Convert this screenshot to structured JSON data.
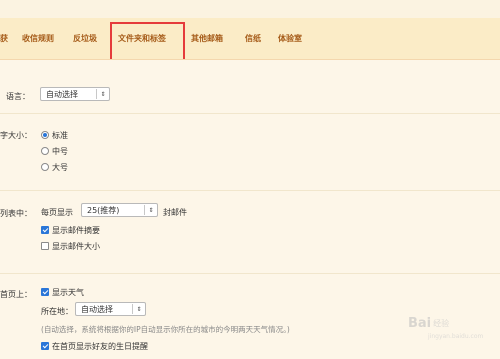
{
  "tabs": [
    {
      "label": "获"
    },
    {
      "label": "收信规则"
    },
    {
      "label": "反垃圾"
    },
    {
      "label": "文件夹和标签"
    },
    {
      "label": "其他邮箱"
    },
    {
      "label": "信纸"
    },
    {
      "label": "体验室"
    }
  ],
  "settings": {
    "language": {
      "label": "语言：",
      "value": "自动选择"
    },
    "font_size": {
      "label": "字大小：",
      "options": [
        {
          "label": "标准",
          "selected": true
        },
        {
          "label": "中号",
          "selected": false
        },
        {
          "label": "大号",
          "selected": false
        }
      ]
    },
    "mail_list": {
      "label": "列表中：",
      "per_page_prefix": "每页显示",
      "per_page_value": "25(推荐)",
      "per_page_suffix": "封邮件",
      "show_summary": {
        "label": "显示邮件摘要",
        "checked": true
      },
      "show_size": {
        "label": "显示邮件大小",
        "checked": false
      }
    },
    "home": {
      "label": "首页上：",
      "show_weather": {
        "label": "显示天气",
        "checked": true
      },
      "location_label": "所在地：",
      "location_value": "自动选择",
      "note": "(自动选择，系统将根据你的IP自动显示你所在的城市的今明两天天气情况。)",
      "birthday": {
        "label": "在首页显示好友的生日提醒",
        "checked": true
      }
    }
  },
  "watermark": {
    "logo": "Bai",
    "text": "经验",
    "url": "jingyan.baidu.com"
  },
  "colors": {
    "accent": "#a65c1a",
    "highlight_box": "#e53b3b",
    "panel": "#fdf6e8",
    "tabbar": "#fbecc7"
  }
}
